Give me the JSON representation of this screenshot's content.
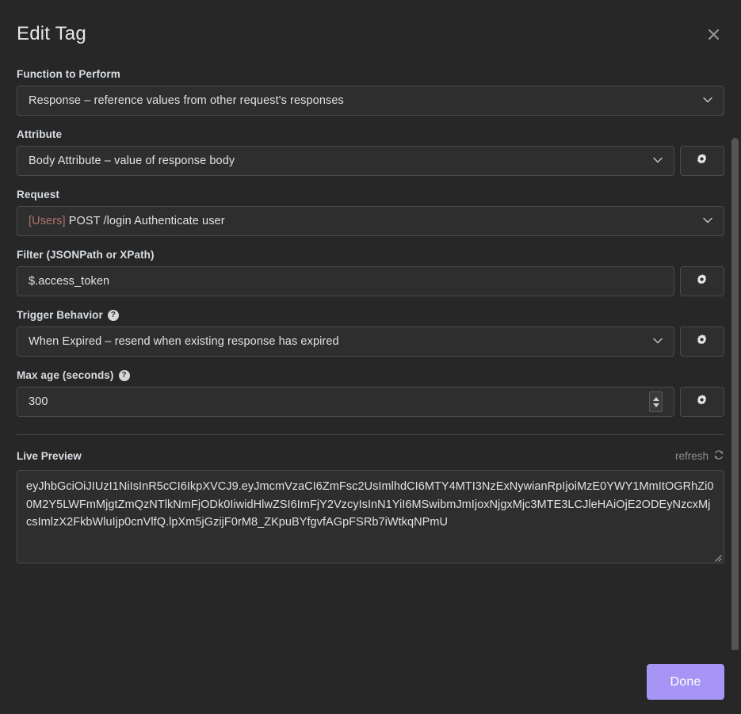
{
  "dialog": {
    "title": "Edit Tag",
    "close_icon": "close-icon"
  },
  "fields": {
    "function": {
      "label": "Function to Perform",
      "value": "Response – reference values from other request's responses"
    },
    "attribute": {
      "label": "Attribute",
      "value": "Body Attribute – value of response body",
      "gear_icon": "gear-icon"
    },
    "request": {
      "label": "Request",
      "value_prefix": "[Users]",
      "value": " POST /login Authenticate user"
    },
    "filter": {
      "label": "Filter (JSONPath or XPath)",
      "value": "$.access_token",
      "gear_icon": "gear-icon"
    },
    "trigger": {
      "label": "Trigger Behavior",
      "help_icon": "help-icon",
      "help_glyph": "?",
      "value": "When Expired – resend when existing response has expired",
      "gear_icon": "gear-icon"
    },
    "max_age": {
      "label": "Max age (seconds)",
      "help_icon": "help-icon",
      "help_glyph": "?",
      "value": "300",
      "gear_icon": "gear-icon"
    }
  },
  "preview": {
    "title": "Live Preview",
    "refresh_label": "refresh",
    "refresh_icon": "refresh-icon",
    "value": "eyJhbGciOiJIUzI1NiIsInR5cCI6IkpXVCJ9.eyJmcmVzaCI6ZmFsc2UsImlhdCI6MTY4MTI3NzExNywianRpIjoiMzE0YWY1MmItOGRhZi00M2Y5LWFmMjgtZmQzNTlkNmFjODk0IiwidHlwZSI6ImFjY2VzcyIsInN1YiI6MSwibmJmIjoxNjgxMjc3MTE3LCJleHAiOjE2ODEyNzcxMjcsImlzX2FkbWluIjp0cnVlfQ.lpXm5jGzijF0rM8_ZKpuBYfgvfAGpFSRb7iWtkqNPmU"
  },
  "footer": {
    "done_label": "Done"
  },
  "colors": {
    "accent": "#a795f6",
    "background": "#272727",
    "field_background": "#2e2e2e",
    "border": "#4b4b4b",
    "label_text": "#d8dde3",
    "tag_prefix": "#b0756c"
  }
}
